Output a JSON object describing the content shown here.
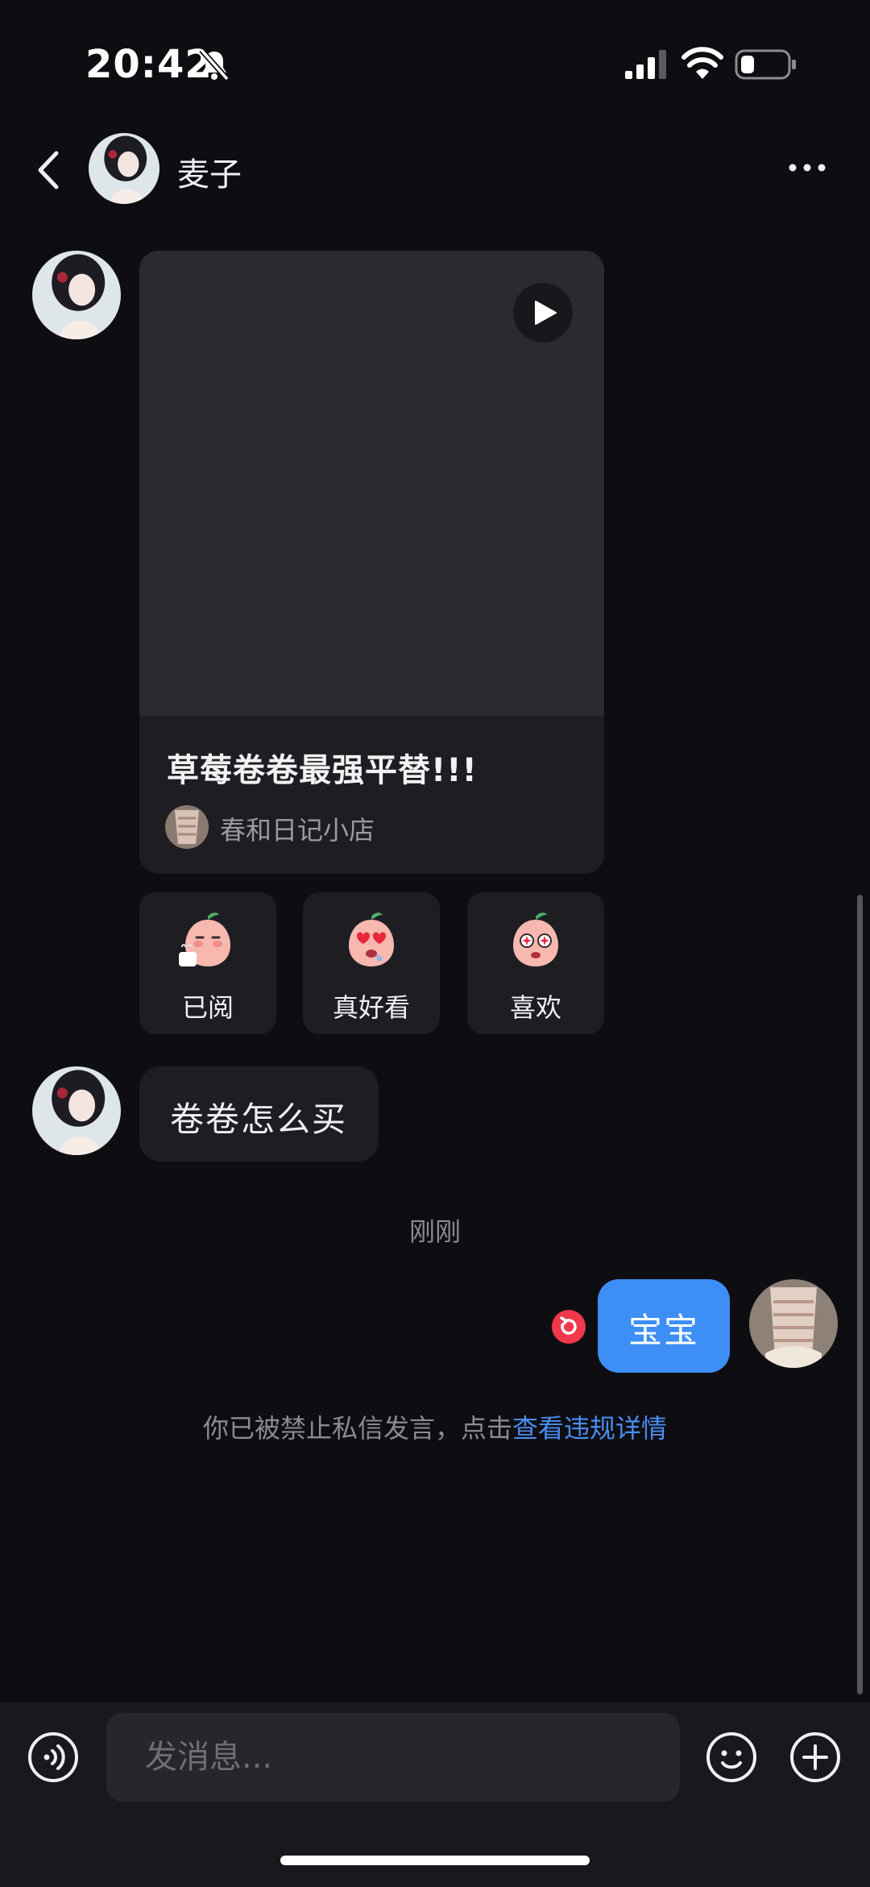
{
  "status_bar": {
    "time": "20:42"
  },
  "header": {
    "contact_name": "麦子"
  },
  "shared_post": {
    "title": "草莓卷卷最强平替!!!",
    "author": "春和日记小店"
  },
  "reactions": [
    {
      "label": "已阅",
      "icon": "peach-tea-emoji-icon"
    },
    {
      "label": "真好看",
      "icon": "peach-heart-eyes-emoji-icon"
    },
    {
      "label": "喜欢",
      "icon": "peach-starry-eyes-emoji-icon"
    }
  ],
  "messages": {
    "incoming_text": "卷卷怎么买",
    "timestamp": "刚刚",
    "outgoing_text": "宝宝"
  },
  "system_notice": {
    "text": "你已被禁止私信发言，点击",
    "link": "查看违规详情"
  },
  "input_bar": {
    "placeholder": "发消息..."
  },
  "colors": {
    "background": "#0e0e12",
    "bubble_incoming": "#1e1e22",
    "bubble_outgoing": "#3d8ff6",
    "link": "#4a8cf0",
    "error": "#f0384a"
  }
}
